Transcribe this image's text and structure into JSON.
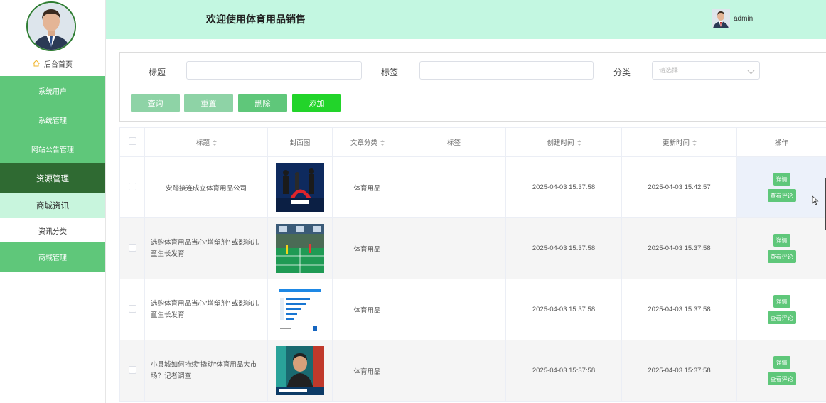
{
  "header": {
    "title": "欢迎使用体育用品销售",
    "username": "admin"
  },
  "sidebar": {
    "home": "后台首页",
    "items": [
      {
        "label": "系统用户",
        "state": "normal"
      },
      {
        "label": "系统管理",
        "state": "normal"
      },
      {
        "label": "网站公告管理",
        "state": "normal"
      },
      {
        "label": "资源管理",
        "state": "expanded"
      },
      {
        "label": "商城资讯",
        "state": "active"
      },
      {
        "label": "资讯分类",
        "state": "sub"
      },
      {
        "label": "商城管理",
        "state": "normal"
      }
    ]
  },
  "search": {
    "title_label": "标题",
    "tag_label": "标签",
    "category_label": "分类",
    "category_placeholder": "请选择",
    "buttons": {
      "query": "查询",
      "reset": "重置",
      "delete": "删除",
      "add": "添加"
    }
  },
  "table": {
    "headers": [
      "标题",
      "封面图",
      "文章分类",
      "标签",
      "创建时间",
      "更新时间",
      "操作"
    ],
    "rows": [
      {
        "title": "安踏接连成立体育用品公司",
        "category": "体育用品",
        "tag": "",
        "created": "2025-04-03 15:37:58",
        "updated": "2025-04-03 15:42:57"
      },
      {
        "title": "选购体育用品当心\"增塑剂\" 或影响儿童生长发育",
        "category": "体育用品",
        "tag": "",
        "created": "2025-04-03 15:37:58",
        "updated": "2025-04-03 15:37:58"
      },
      {
        "title": "选购体育用品当心\"增塑剂\" 或影响儿童生长发育",
        "category": "体育用品",
        "tag": "",
        "created": "2025-04-03 15:37:58",
        "updated": "2025-04-03 15:37:58"
      },
      {
        "title": "小县城如何持续\"撬动\"体育用品大市场？记者调查",
        "category": "体育用品",
        "tag": "",
        "created": "2025-04-03 15:37:58",
        "updated": "2025-04-03 15:37:58"
      }
    ],
    "actions": {
      "detail": "详情",
      "comments": "查看评论"
    }
  },
  "colors": {
    "header_bg": "#c3f7e1",
    "menu_green": "#5fc77a",
    "menu_dark": "#2f6a32",
    "menu_active": "#c8f5dd",
    "btn_query": "#8ed3a6",
    "btn_add": "#22d42a"
  },
  "icons": [
    "home-icon",
    "chevron-down-icon",
    "sort-icon",
    "mouse-cursor-icon"
  ]
}
